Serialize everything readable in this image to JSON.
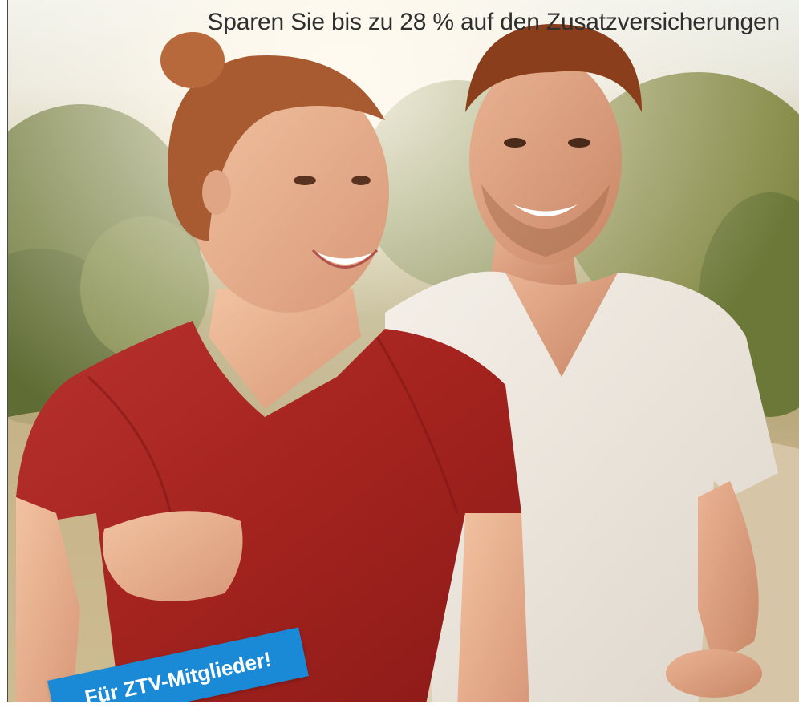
{
  "headline": {
    "text": "Sparen Sie bis zu 28 % auf den Zusatzversicherungen"
  },
  "badge": {
    "text": "Für ZTV-Mitglieder!",
    "color": "#1b8ad6"
  },
  "photo": {
    "subject": "woman-in-red-shirt-and-man-in-white-shirt-jogging"
  }
}
